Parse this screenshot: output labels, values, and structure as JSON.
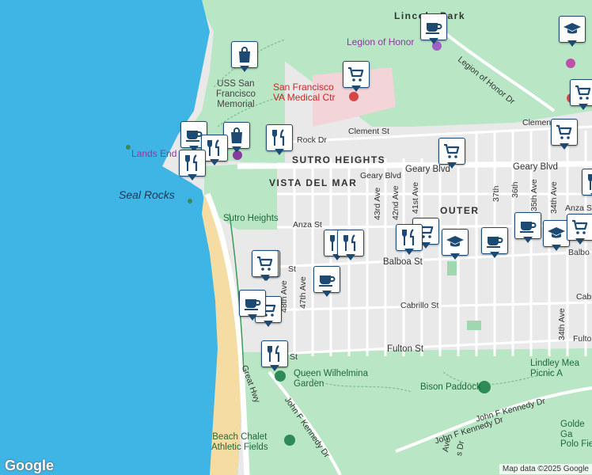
{
  "labels": {
    "park_lincoln": "Lincoln Park",
    "legion": "Legion of Honor",
    "legion_dr": "Legion of Honor Dr",
    "uss_sf": "USS San\nFrancisco\nMemorial",
    "va": "San Francisco\nVA Medical Ctr",
    "clement_w": "Clement St",
    "clement_e": "Clement St",
    "el_camino": "Rock Dr",
    "lands_end": "Lands End",
    "sutro_heights_nbh": "SUTRO HEIGHTS",
    "vista_del_mar": "VISTA DEL MAR",
    "seal_rocks": "Seal Rocks",
    "geary_w": "Geary Blvd",
    "geary_m": "Geary Blvd",
    "geary_e": "Geary Blvd",
    "sutro_heights_park": "Sutro Heights",
    "anza_w": "Anza St",
    "anza_e": "Anza St",
    "outer": "OUTER",
    "ave_43": "43rd Ave",
    "ave_42": "42nd Ave",
    "ave_41": "41st Ave",
    "ave_37": "37th",
    "ave_36": "36th",
    "ave_35": "35th Ave",
    "ave_34a": "34th Ave",
    "ave_34b": "34th Ave",
    "ave_48": "48th Ave",
    "ave_47": "47th Ave",
    "balboa_w": "St",
    "balboa_m": "Balboa St",
    "balboa_e": "Balbo",
    "cabrillo": "Cabrillo St",
    "cabrillo_e": "Cabr",
    "fulton_w": "F",
    "fulton_w2": "St",
    "fulton_m": "Fulton St",
    "fulton_e": "Fulto",
    "great_hwy": "Great Hwy",
    "queen": "Queen Wilhelmina\nGarden",
    "bison": "Bison Paddock",
    "lindley": "Lindley Mea\nPicnic A",
    "jfk1": "John F Kennedy Dr",
    "jfk2": "John F Kennedy Dr",
    "jfk3": "John F Kennedy Dr",
    "golden": "Golde\nGa\nPolo Fie",
    "beach_chalet": "Beach Chalet\nAthletic Fields",
    "ave_42b": "Ave",
    "ave_41b": "s Dr",
    "google": "Google",
    "attribution": "Map data ©2025 Google"
  },
  "markers": [
    {
      "icon": "bag-icon",
      "kind": "shopping"
    },
    {
      "icon": "cart-icon",
      "kind": "grocery"
    },
    {
      "icon": "coffee-icon",
      "kind": "cafe"
    },
    {
      "icon": "graduation-cap-icon",
      "kind": "school"
    },
    {
      "icon": "cart-icon",
      "kind": "grocery"
    },
    {
      "icon": "coffee-icon",
      "kind": "cafe"
    },
    {
      "icon": "fork-knife-icon",
      "kind": "restaurant"
    },
    {
      "icon": "bag-icon",
      "kind": "shopping"
    },
    {
      "icon": "fork-knife-icon",
      "kind": "restaurant"
    },
    {
      "icon": "fork-knife-icon",
      "kind": "restaurant"
    },
    {
      "icon": "fork-knife-icon",
      "kind": "restaurant"
    },
    {
      "icon": "cart-icon",
      "kind": "grocery"
    },
    {
      "icon": "cart-icon",
      "kind": "grocery"
    },
    {
      "icon": "cart-icon",
      "kind": "grocery"
    },
    {
      "icon": "fork-knife-icon",
      "kind": "restaurant"
    },
    {
      "icon": "fork-knife-icon",
      "kind": "restaurant"
    },
    {
      "icon": "cart-icon",
      "kind": "grocery"
    },
    {
      "icon": "fork-knife-icon",
      "kind": "restaurant"
    },
    {
      "icon": "graduation-cap-icon",
      "kind": "school"
    },
    {
      "icon": "coffee-icon",
      "kind": "cafe"
    },
    {
      "icon": "coffee-icon",
      "kind": "cafe"
    },
    {
      "icon": "graduation-cap-icon",
      "kind": "school"
    },
    {
      "icon": "cart-icon",
      "kind": "grocery"
    },
    {
      "icon": "coffee-icon",
      "kind": "cafe"
    },
    {
      "icon": "cart-icon",
      "kind": "grocery"
    },
    {
      "icon": "coffee-icon",
      "kind": "cafe"
    },
    {
      "icon": "cart-icon",
      "kind": "grocery"
    },
    {
      "icon": "fork-knife-icon",
      "kind": "restaurant"
    }
  ],
  "colors": {
    "water": "#3fb5e6",
    "park": "#b9e6c5",
    "land": "#e8e8e8",
    "road": "#ffffff",
    "beach": "#f4dca3",
    "pin_border": "#1c4a73",
    "icon": "#1c4a73"
  }
}
